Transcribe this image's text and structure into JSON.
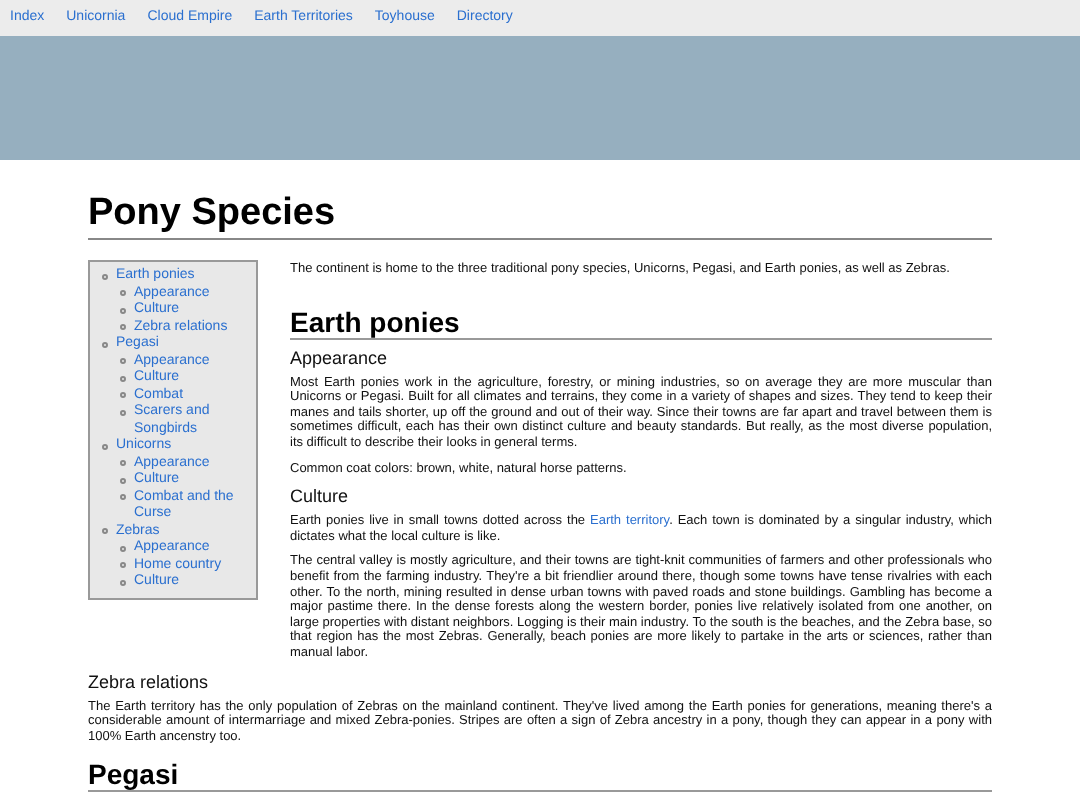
{
  "nav": [
    {
      "label": "Index"
    },
    {
      "label": "Unicornia"
    },
    {
      "label": "Cloud Empire"
    },
    {
      "label": "Earth Territories"
    },
    {
      "label": "Toyhouse"
    },
    {
      "label": "Directory"
    }
  ],
  "title": "Pony Species",
  "toc": [
    {
      "label": "Earth ponies",
      "children": [
        {
          "label": "Appearance"
        },
        {
          "label": "Culture"
        },
        {
          "label": "Zebra relations"
        }
      ]
    },
    {
      "label": "Pegasi",
      "children": [
        {
          "label": "Appearance"
        },
        {
          "label": "Culture"
        },
        {
          "label": "Combat"
        },
        {
          "label": "Scarers and Songbirds"
        }
      ]
    },
    {
      "label": "Unicorns",
      "children": [
        {
          "label": "Appearance"
        },
        {
          "label": "Culture"
        },
        {
          "label": "Combat and the Curse"
        }
      ]
    },
    {
      "label": "Zebras",
      "children": [
        {
          "label": "Appearance"
        },
        {
          "label": "Home country"
        },
        {
          "label": "Culture"
        }
      ]
    }
  ],
  "intro": "The continent is home to the three traditional pony species, Unicorns, Pegasi, and Earth ponies, as well as Zebras.",
  "blocks": [
    {
      "kind": "h2",
      "text": "Earth ponies"
    },
    {
      "kind": "h3",
      "text": "Appearance"
    },
    {
      "kind": "p",
      "parts": [
        {
          "kind": "text",
          "text": "Most Earth ponies work in the agriculture, forestry, or mining industries, so on average they are more muscular than Unicorns or Pegasi. Built for all climates and terrains, they come in a variety of shapes and sizes. They tend to keep their manes and tails shorter, up off the ground and out of their way. Since their towns are far apart and travel between them is sometimes difficult, each has their own distinct culture and beauty standards. But really, as the most diverse population, its difficult to describe their looks in general terms."
        }
      ]
    },
    {
      "kind": "p",
      "parts": [
        {
          "kind": "text",
          "text": "Common coat colors: brown, white, natural horse patterns."
        }
      ]
    },
    {
      "kind": "h3",
      "text": "Culture"
    },
    {
      "kind": "p",
      "parts": [
        {
          "kind": "text",
          "text": "Earth ponies live in small towns dotted across the "
        },
        {
          "kind": "link",
          "text": "Earth territory"
        },
        {
          "kind": "text",
          "text": ". Each town is dominated by a singular industry, which dictates what the local culture is like."
        }
      ]
    },
    {
      "kind": "p",
      "parts": [
        {
          "kind": "text",
          "text": "The central valley is mostly agriculture, and their towns are tight-knit communities of farmers and other professionals who benefit from the farming industry. They're a bit friendlier around there, though some towns have tense rivalries with each other. To the north, mining resulted in dense urban towns with paved roads and stone buildings. Gambling has become a major pastime there. In the dense forests along the western border, ponies live relatively isolated from one another, on large properties with distant neighbors. Logging is their main industry. To the south is the beaches, and the Zebra base, so that region has the most Zebras. Generally, beach ponies are more likely to partake in the arts or sciences, rather than manual labor."
        }
      ]
    },
    {
      "kind": "h3",
      "text": "Zebra relations"
    },
    {
      "kind": "p",
      "parts": [
        {
          "kind": "text",
          "text": "The Earth territory has the only population of Zebras on the mainland continent. They've lived among the Earth ponies for generations, meaning there's a considerable amount of intermarriage and mixed Zebra-ponies. Stripes are often a sign of Zebra ancestry in a pony, though they can appear in a pony with 100% Earth ancenstry too."
        }
      ]
    },
    {
      "kind": "h2",
      "text": "Pegasi"
    }
  ]
}
